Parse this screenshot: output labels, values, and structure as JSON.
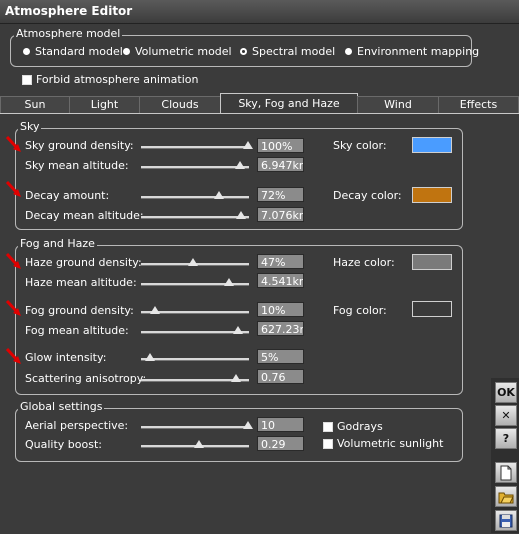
{
  "window": {
    "title": "Atmosphere Editor"
  },
  "model": {
    "group_label": "Atmosphere model",
    "options": [
      {
        "label": "Standard model",
        "selected": false
      },
      {
        "label": "Volumetric model",
        "selected": false
      },
      {
        "label": "Spectral model",
        "selected": true
      },
      {
        "label": "Environment mapping",
        "selected": false
      }
    ]
  },
  "forbid_animation": {
    "label": "Forbid atmosphere animation",
    "checked": false
  },
  "tabs": [
    {
      "label": "Sun",
      "active": false
    },
    {
      "label": "Light",
      "active": false
    },
    {
      "label": "Clouds",
      "active": false
    },
    {
      "label": "Sky, Fog and Haze",
      "active": true
    },
    {
      "label": "Wind",
      "active": false
    },
    {
      "label": "Effects",
      "active": false
    }
  ],
  "sky": {
    "group_label": "Sky",
    "ground_density": {
      "label": "Sky ground density:",
      "value": "100%",
      "slider": 1.0
    },
    "mean_altitude": {
      "label": "Sky mean altitude:",
      "value": "6.947km",
      "slider": 0.92
    },
    "decay_amount": {
      "label": "Decay amount:",
      "value": "72%",
      "slider": 0.72
    },
    "decay_altitude": {
      "label": "Decay mean altitude:",
      "value": "7.076km",
      "slider": 0.93
    },
    "sky_color": {
      "label": "Sky color:",
      "color": "#4a9cff"
    },
    "decay_color": {
      "label": "Decay color:",
      "color": "#c07410"
    }
  },
  "fog": {
    "group_label": "Fog and Haze",
    "haze_density": {
      "label": "Haze ground density:",
      "value": "47%",
      "slider": 0.47
    },
    "haze_altitude": {
      "label": "Haze mean altitude:",
      "value": "4.541km",
      "slider": 0.82
    },
    "fog_density": {
      "label": "Fog ground density:",
      "value": "10%",
      "slider": 0.1
    },
    "fog_altitude": {
      "label": "Fog mean altitude:",
      "value": "627.23m",
      "slider": 0.9
    },
    "glow": {
      "label": "Glow intensity:",
      "value": "5%",
      "slider": 0.05
    },
    "scattering": {
      "label": "Scattering anisotropy:",
      "value": "0.76",
      "slider": 0.88
    },
    "haze_color": {
      "label": "Haze color:",
      "color": "#7a7a7a"
    },
    "fog_color": {
      "label": "Fog color:",
      "color": "#3a3a3a"
    }
  },
  "global": {
    "group_label": "Global settings",
    "aerial": {
      "label": "Aerial perspective:",
      "value": "10",
      "slider": 1.0
    },
    "quality": {
      "label": "Quality boost:",
      "value": "0.29",
      "slider": 0.52
    },
    "godrays": {
      "label": "Godrays",
      "checked": false
    },
    "volumetric": {
      "label": "Volumetric sunlight",
      "checked": false
    }
  },
  "side_buttons": {
    "ok": "OK",
    "close": "✕",
    "help": "?"
  },
  "side_icons": [
    "new-document-icon",
    "open-folder-icon",
    "save-disk-icon"
  ]
}
